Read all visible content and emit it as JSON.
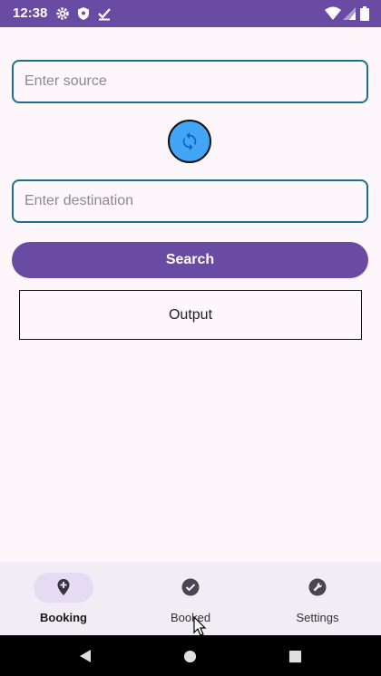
{
  "status_bar": {
    "time": "12:38",
    "left_icons": [
      "gear-icon",
      "shield-icon",
      "download-check-icon"
    ],
    "right_icons": [
      "wifi-icon",
      "signal-icon",
      "battery-icon"
    ],
    "colors": {
      "background": "#6a4ba3"
    }
  },
  "form": {
    "source_placeholder": "Enter source",
    "source_value": "",
    "destination_placeholder": "Enter destination",
    "destination_value": "",
    "swap_icon": "swap-icon",
    "search_label": "Search",
    "output_text": "Output"
  },
  "bottom_nav": {
    "items": [
      {
        "label": "Booking",
        "icon": "location-add-icon",
        "active": true
      },
      {
        "label": "Booked",
        "icon": "check-circle-icon",
        "active": false
      },
      {
        "label": "Settings",
        "icon": "wrench-icon",
        "active": false
      }
    ]
  },
  "system_nav": {
    "icons": [
      "back-icon",
      "home-icon",
      "recents-icon"
    ]
  },
  "colors": {
    "primary": "#6a4ba3",
    "swap_button": "#42a5f5",
    "field_border": "#1f6f8b"
  }
}
